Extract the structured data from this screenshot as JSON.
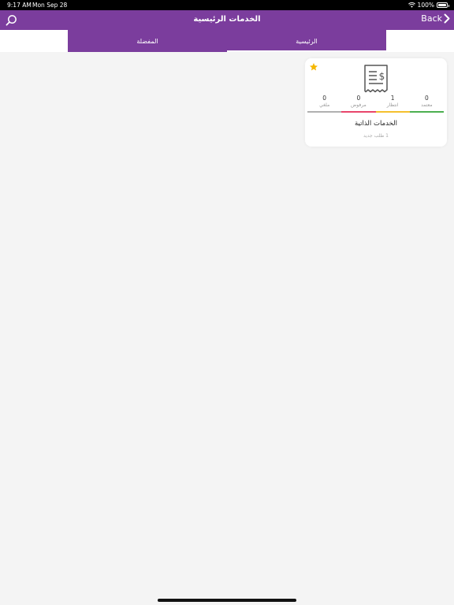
{
  "status_bar": {
    "time": "9:17 AM",
    "date": "Mon Sep 28",
    "battery": "100%"
  },
  "nav": {
    "title": "الخدمات الرئيسية",
    "back_label": "Back",
    "search_icon": "search-icon",
    "back_icon": "chevron-right-icon"
  },
  "tabs": [
    {
      "label": "المفضلة",
      "active": false
    },
    {
      "label": "الرئيسية",
      "active": true
    }
  ],
  "card": {
    "name": "الخدمات الذاتية",
    "subtitle": "1 طلب جديد",
    "favorite": true,
    "icon": "receipt-dollar-icon",
    "stats": [
      {
        "value": "0",
        "label": "معتمد",
        "color": "#4caf50"
      },
      {
        "value": "1",
        "label": "انتظار",
        "color": "#f5c02e"
      },
      {
        "value": "0",
        "label": "مرفوض",
        "color": "#e8456b"
      },
      {
        "value": "0",
        "label": "ملغي",
        "color": "#b0b0b0"
      }
    ]
  },
  "colors": {
    "primary": "#7b3d9d",
    "star": "#f5b700"
  }
}
